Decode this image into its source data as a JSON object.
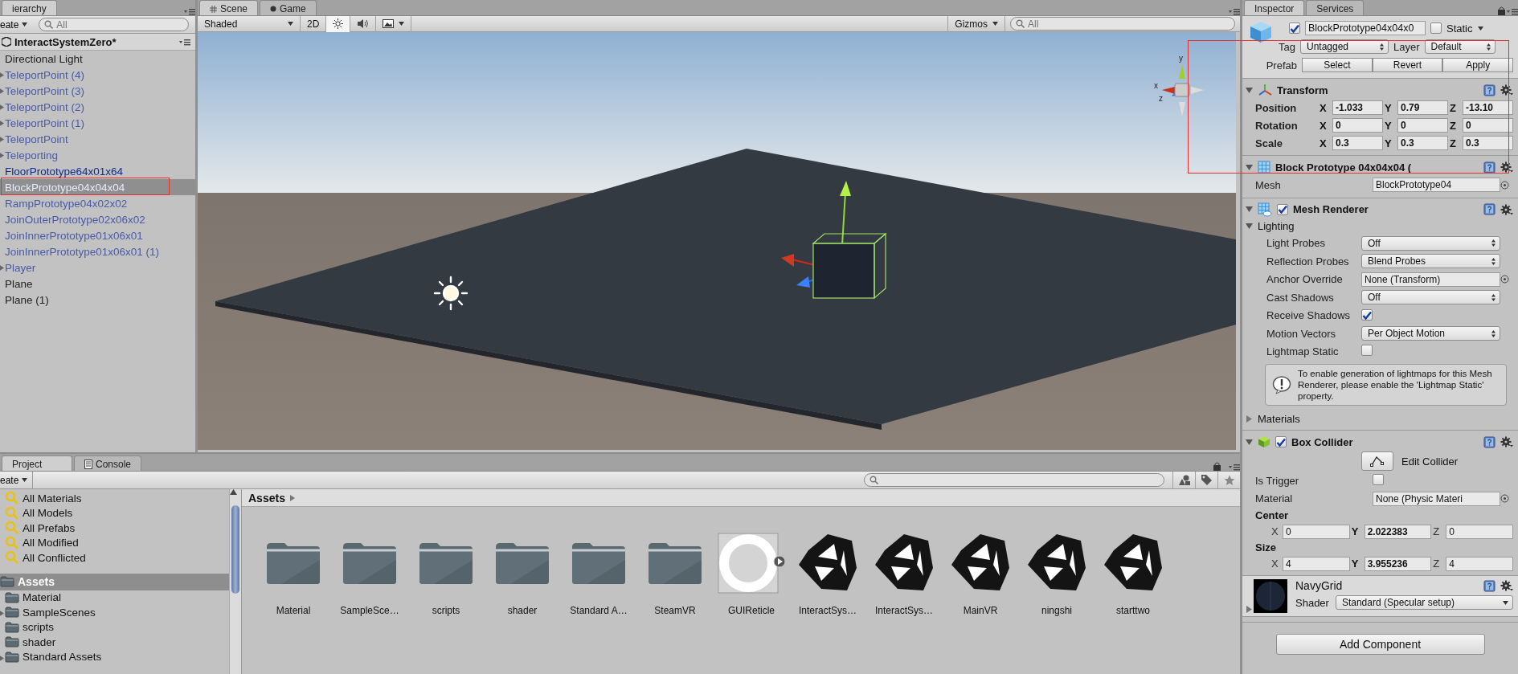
{
  "hierarchy": {
    "tab": "ierarchy",
    "create": "eate",
    "search_placeholder": "All",
    "scene_name": "InteractSystemZero*",
    "items": [
      {
        "label": "Directional Light",
        "kind": "object",
        "collapsible": false,
        "selected": false
      },
      {
        "label": "TeleportPoint (4)",
        "kind": "prefab",
        "collapsible": true,
        "selected": false
      },
      {
        "label": "TeleportPoint (3)",
        "kind": "prefab",
        "collapsible": true,
        "selected": false
      },
      {
        "label": "TeleportPoint (2)",
        "kind": "prefab",
        "collapsible": true,
        "selected": false
      },
      {
        "label": "TeleportPoint (1)",
        "kind": "prefab",
        "collapsible": true,
        "selected": false
      },
      {
        "label": "TeleportPoint",
        "kind": "prefab",
        "collapsible": true,
        "selected": false
      },
      {
        "label": "Teleporting",
        "kind": "prefab",
        "collapsible": true,
        "selected": false
      },
      {
        "label": "FloorPrototype64x01x64",
        "kind": "prefabroot",
        "collapsible": false,
        "selected": false
      },
      {
        "label": "BlockPrototype04x04x04",
        "kind": "prefab",
        "collapsible": false,
        "selected": true
      },
      {
        "label": "RampPrototype04x02x02",
        "kind": "prefab",
        "collapsible": false,
        "selected": false
      },
      {
        "label": "JoinOuterPrototype02x06x02",
        "kind": "prefab",
        "collapsible": false,
        "selected": false
      },
      {
        "label": "JoinInnerPrototype01x06x01",
        "kind": "prefab",
        "collapsible": false,
        "selected": false
      },
      {
        "label": "JoinInnerPrototype01x06x01 (1)",
        "kind": "prefab",
        "collapsible": false,
        "selected": false
      },
      {
        "label": "Player",
        "kind": "prefab",
        "collapsible": true,
        "selected": false
      },
      {
        "label": "Plane",
        "kind": "object",
        "collapsible": false,
        "selected": false
      },
      {
        "label": "Plane (1)",
        "kind": "object",
        "collapsible": false,
        "selected": false
      }
    ]
  },
  "scene": {
    "tabs": [
      {
        "label": "Scene",
        "selected": true
      },
      {
        "label": "Game",
        "selected": false
      }
    ],
    "shading": "Shaded",
    "mode_2d": "2D",
    "lighting": true,
    "audio": false,
    "gizmos": "Gizmos",
    "search_placeholder": "All",
    "gizmo_axes": [
      "y",
      "x",
      "z"
    ]
  },
  "inspector": {
    "tabs": [
      {
        "label": "Inspector",
        "selected": true
      },
      {
        "label": "Services",
        "selected": false
      }
    ],
    "object": {
      "active": true,
      "name": "BlockPrototype04x04x0",
      "static": false,
      "static_label": "Static",
      "tag_label": "Tag",
      "tag": "Untagged",
      "layer_label": "Layer",
      "layer": "Default",
      "prefab_label": "Prefab",
      "prefab_buttons": [
        "Select",
        "Revert",
        "Apply"
      ]
    },
    "components": [
      {
        "kind": "transform",
        "title": "Transform",
        "expanded": true,
        "rows": [
          {
            "label": "Position",
            "fields": [
              {
                "axis": "X",
                "value": "-1.033"
              },
              {
                "axis": "Y",
                "value": "0.79"
              },
              {
                "axis": "Z",
                "value": "-13.10"
              }
            ]
          },
          {
            "label": "Rotation",
            "fields": [
              {
                "axis": "X",
                "value": "0"
              },
              {
                "axis": "Y",
                "value": "0"
              },
              {
                "axis": "Z",
                "value": "0"
              }
            ]
          },
          {
            "label": "Scale",
            "fields": [
              {
                "axis": "X",
                "value": "0.3"
              },
              {
                "axis": "Y",
                "value": "0.3"
              },
              {
                "axis": "Z",
                "value": "0.3"
              }
            ]
          }
        ]
      },
      {
        "kind": "meshfilter",
        "title": "Block Prototype 04x04x04 (",
        "expanded": true,
        "props": [
          {
            "label": "Mesh",
            "kind": "object",
            "value": "BlockPrototype04"
          }
        ]
      },
      {
        "kind": "renderer",
        "title": "Mesh Renderer",
        "enabled": true,
        "expanded": true,
        "section": {
          "label": "Lighting",
          "expanded": true,
          "props": [
            {
              "label": "Light Probes",
              "kind": "dropdown",
              "value": "Off"
            },
            {
              "label": "Reflection Probes",
              "kind": "dropdown",
              "value": "Blend Probes"
            },
            {
              "label": "Anchor Override",
              "kind": "object",
              "value": "None (Transform)"
            },
            {
              "label": "Cast Shadows",
              "kind": "dropdown",
              "value": "Off"
            },
            {
              "label": "Receive Shadows",
              "kind": "check",
              "checked": true
            },
            {
              "label": "Motion Vectors",
              "kind": "dropdown",
              "value": "Per Object Motion"
            },
            {
              "label": "Lightmap Static",
              "kind": "check",
              "checked": false
            }
          ]
        },
        "help": "To enable generation of lightmaps for this Mesh Renderer, please enable the 'Lightmap Static' property.",
        "materials": {
          "label": "Materials",
          "expanded": false
        }
      },
      {
        "kind": "collider",
        "title": "Box Collider",
        "enabled": true,
        "expanded": true,
        "edit_button": "Edit Collider",
        "props": [
          {
            "label": "Is Trigger",
            "kind": "check",
            "checked": false
          },
          {
            "label": "Material",
            "kind": "object",
            "value": "None (Physic Materi"
          }
        ],
        "vectors": [
          {
            "label": "Center",
            "fields": [
              {
                "axis": "X",
                "value": "0"
              },
              {
                "axis": "Y",
                "value": "2.022383"
              },
              {
                "axis": "Z",
                "value": "0"
              }
            ]
          },
          {
            "label": "Size",
            "fields": [
              {
                "axis": "X",
                "value": "4"
              },
              {
                "axis": "Y",
                "value": "3.955236"
              },
              {
                "axis": "Z",
                "value": "4"
              }
            ]
          }
        ]
      }
    ],
    "material": {
      "name": "NavyGrid",
      "expanded": false,
      "shader_label": "Shader",
      "shader": "Standard (Specular setup)"
    },
    "add_component": "Add Component"
  },
  "project": {
    "tabs": [
      {
        "label": "Project",
        "kind": "project",
        "selected": true
      },
      {
        "label": "Console",
        "kind": "console",
        "selected": false
      }
    ],
    "create": "eate",
    "favorites": [
      "All Materials",
      "All Models",
      "All Prefabs",
      "All Modified",
      "All Conflicted"
    ],
    "tree": {
      "label": "Assets",
      "selected": true,
      "children": [
        {
          "label": "Material",
          "collapsible": false
        },
        {
          "label": "SampleScenes",
          "collapsible": true
        },
        {
          "label": "scripts",
          "collapsible": false
        },
        {
          "label": "shader",
          "collapsible": false
        },
        {
          "label": "Standard Assets",
          "collapsible": true
        }
      ]
    },
    "breadcrumb": "Assets",
    "assets": [
      {
        "label": "Material",
        "kind": "folder"
      },
      {
        "label": "SampleSce…",
        "kind": "folder"
      },
      {
        "label": "scripts",
        "kind": "folder"
      },
      {
        "label": "shader",
        "kind": "folder"
      },
      {
        "label": "Standard A…",
        "kind": "folder"
      },
      {
        "label": "SteamVR",
        "kind": "folder"
      },
      {
        "label": "GUIReticle",
        "kind": "texture"
      },
      {
        "label": "InteractSys…",
        "kind": "scene"
      },
      {
        "label": "InteractSys…",
        "kind": "scene"
      },
      {
        "label": "MainVR",
        "kind": "scene"
      },
      {
        "label": "ningshi",
        "kind": "scene"
      },
      {
        "label": "starttwo",
        "kind": "scene"
      }
    ]
  }
}
